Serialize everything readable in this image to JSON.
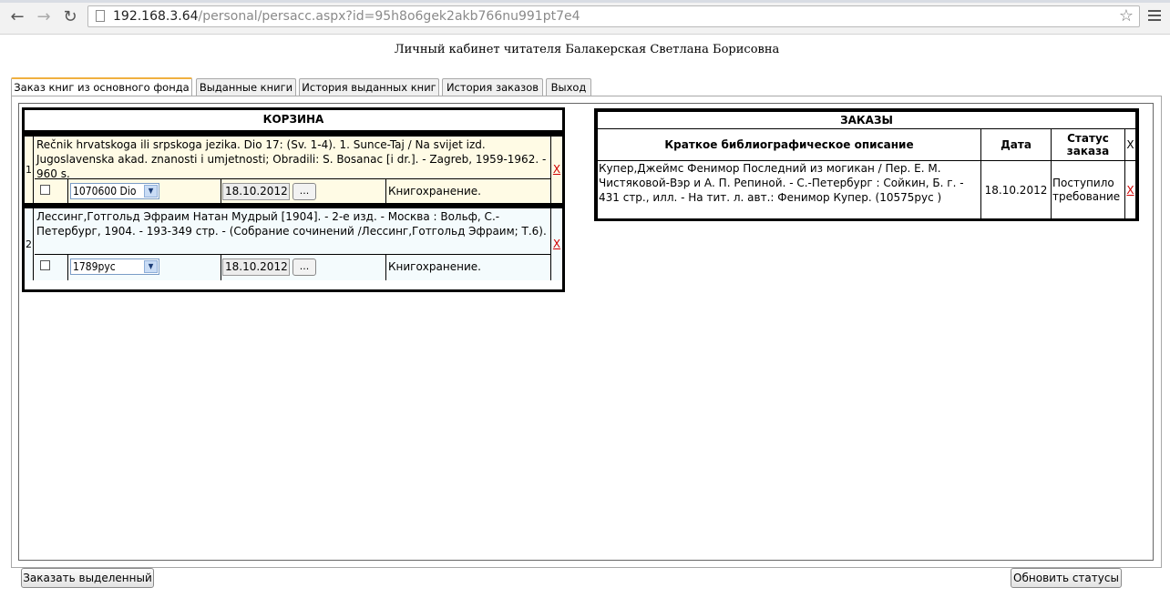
{
  "browser": {
    "url_host": "192.168.3.64",
    "url_path": "/personal/persacc.aspx?id=95h8o6gek2akb766nu991pt7e4"
  },
  "page_title": "Личный кабинет читателя Балакерская Светлана Борисовна",
  "tabs": [
    {
      "label": "Заказ книг из основного фонда",
      "active": true
    },
    {
      "label": "Выданные книги"
    },
    {
      "label": "История выданных книг"
    },
    {
      "label": "История заказов"
    },
    {
      "label": "Выход"
    }
  ],
  "cart": {
    "title": "КОРЗИНА",
    "items": [
      {
        "num": "1",
        "description": "Rečnik hrvatskoga ili srpskoga jezika. Dio 17: (Sv. 1-4). 1. Sunce-Taj / Na svijet izd. Jugoslavenska akad. znanosti i umjetnosti; Obradili: S. Bosanac [i dr.]. - Zagreb, 1959-1962. - 960 s.",
        "copy": "1070600 Dio",
        "date": "18.10.2012",
        "dots": "...",
        "location": "Книгохранение.",
        "delete": "X"
      },
      {
        "num": "2",
        "description": "Лессинг,Готгольд Эфраим Натан Мудрый [1904]. - 2-е изд. - Москва : Вольф, С.-Петербург, 1904. - 193-349 стр. - (Собрание сочинений /Лессинг,Готгольд Эфраим; Т.6).",
        "copy": "1789рус",
        "date": "18.10.2012",
        "dots": "...",
        "location": "Книгохранение.",
        "delete": "X"
      }
    ]
  },
  "orders": {
    "title": "ЗАКАЗЫ",
    "columns": [
      "Краткое библиографическое описание",
      "Дата",
      "Статус заказа",
      "X"
    ],
    "rows": [
      {
        "description": "Купер,Джеймс Фенимор Последний из могикан / Пер. Е. М. Чистяковой-Вэр и А. П. Репиной. - С.-Петербург : Сойкин, Б. г. - 431 стр., илл. - На тит. л. авт.: Фенимор Купер. (10575рус )",
        "date": "18.10.2012",
        "status": "Поступило требование",
        "delete": "X"
      }
    ]
  },
  "buttons": {
    "order_selected": "Заказать выделенный",
    "refresh_status": "Обновить статусы"
  },
  "colors": {
    "cart_item1_bg": "#fffbe5",
    "cart_item2_bg": "#f4fbfd",
    "delete_link": "#d00000",
    "active_tab_accent": "#f0b040"
  }
}
